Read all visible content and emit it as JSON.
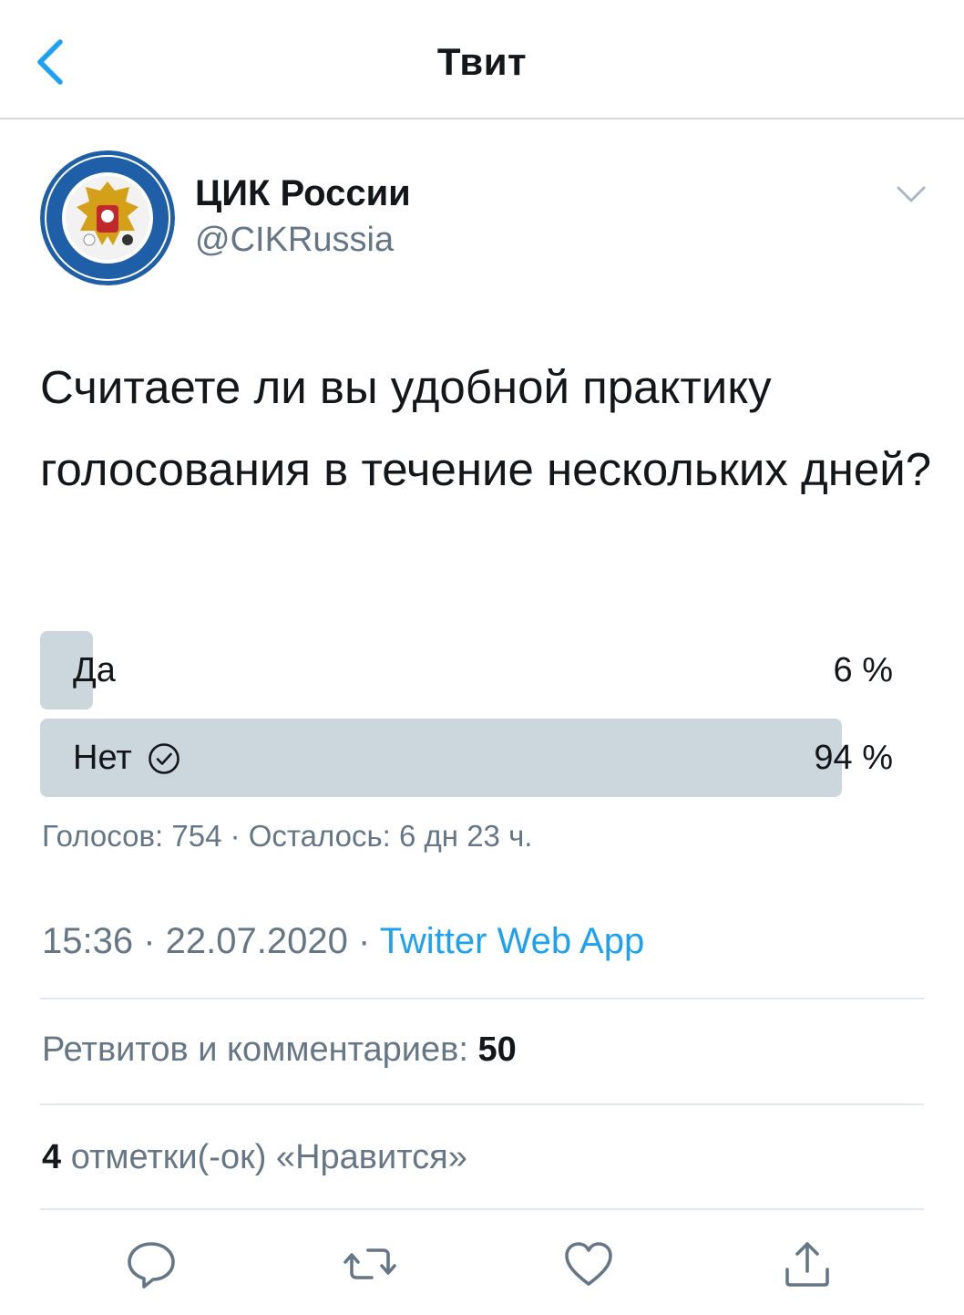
{
  "header": {
    "title": "Твит"
  },
  "author": {
    "name": "ЦИК России",
    "handle": "@CIKRussia"
  },
  "tweet": {
    "text": "Считаете ли вы удобной практику голосования в течение нескольких дней?"
  },
  "poll": {
    "options": [
      {
        "label": "Да",
        "percent_label": "6 %",
        "fraction": 0.06,
        "winner": false
      },
      {
        "label": "Нет",
        "percent_label": "94 %",
        "fraction": 0.94,
        "winner": true
      }
    ],
    "meta": "Голосов: 754 · Осталось: 6 дн 23 ч."
  },
  "details": {
    "time": "15:36",
    "separator": " · ",
    "date": "22.07.2020",
    "source": "Twitter Web App"
  },
  "stats": {
    "retweets_label": "Ретвитов и комментариев: ",
    "retweets_count": "50",
    "likes_count": "4",
    "likes_label": " отметки(-ок) «Нравится»"
  },
  "colors": {
    "accent": "#1da1f2",
    "secondary_text": "#657786",
    "poll_bar": "#ccd6dd"
  },
  "icons": [
    "back-icon",
    "chevron-down-icon",
    "check-circle-icon",
    "reply-icon",
    "retweet-icon",
    "like-icon",
    "share-icon"
  ]
}
